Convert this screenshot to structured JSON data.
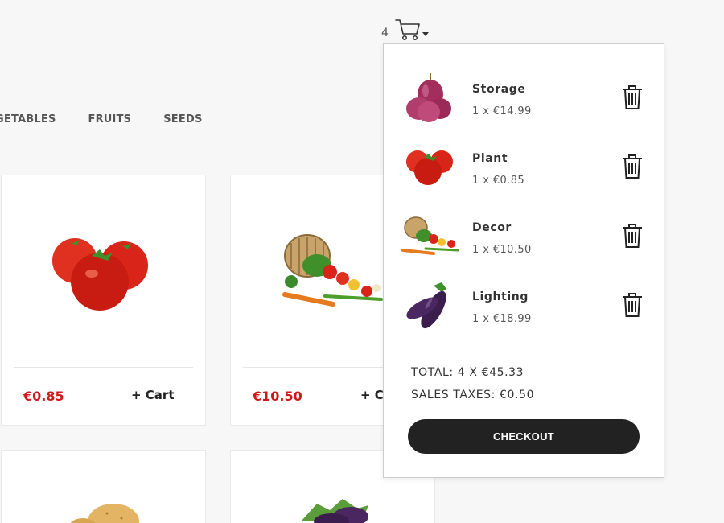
{
  "nav": {
    "items": [
      {
        "label": "GETABLES"
      },
      {
        "label": "FRUITS"
      },
      {
        "label": "SEEDS"
      }
    ]
  },
  "cart": {
    "count": "4",
    "icon": "cart-icon"
  },
  "products": [
    {
      "price": "€0.85",
      "add_label": "+ Cart",
      "image": "tomatoes-image"
    },
    {
      "price": "€10.50",
      "add_label": "+ Ca",
      "image": "vegetable-basket-image"
    },
    {
      "image": "potatoes-image"
    },
    {
      "image": "eggplants-image"
    }
  ],
  "dropdown": {
    "items": [
      {
        "name": "Storage",
        "qty": "1 x €14.99",
        "image": "red-onion-image"
      },
      {
        "name": "Plant",
        "qty": "1 x €0.85",
        "image": "tomatoes-image"
      },
      {
        "name": "Decor",
        "qty": "1 x €10.50",
        "image": "vegetable-basket-image"
      },
      {
        "name": "Lighting",
        "qty": "1 x €18.99",
        "image": "eggplant-image"
      }
    ],
    "total": "TOTAL: 4 X €45.33",
    "tax": "SALES TAXES: €0.50",
    "checkout_label": "CHECKOUT"
  },
  "colors": {
    "price": "#cc1a1a",
    "button": "#222222",
    "background": "#f7f7f7"
  }
}
